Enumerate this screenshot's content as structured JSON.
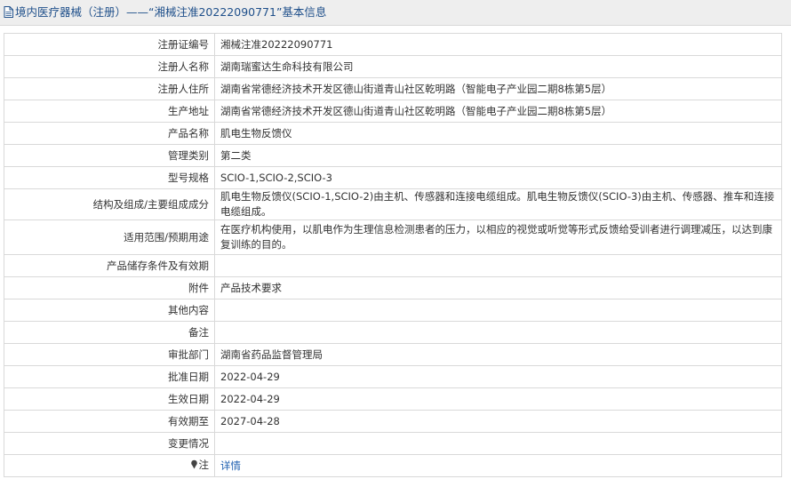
{
  "header": {
    "icon": "document-icon",
    "title": "境内医疗器械（注册）——“湘械注准20222090771”基本信息"
  },
  "rows": [
    {
      "label": "注册证编号",
      "value": "湘械注准20222090771"
    },
    {
      "label": "注册人名称",
      "value": "湖南瑞蜜达生命科技有限公司"
    },
    {
      "label": "注册人住所",
      "value": "湖南省常德经济技术开发区德山街道青山社区乾明路（智能电子产业园二期8栋第5层）"
    },
    {
      "label": "生产地址",
      "value": "湖南省常德经济技术开发区德山街道青山社区乾明路（智能电子产业园二期8栋第5层）"
    },
    {
      "label": "产品名称",
      "value": "肌电生物反馈仪"
    },
    {
      "label": "管理类别",
      "value": "第二类"
    },
    {
      "label": "型号规格",
      "value": "SCIO-1,SCIO-2,SCIO-3"
    },
    {
      "label": "结构及组成/主要组成成分",
      "value": "肌电生物反馈仪(SCIO-1,SCIO-2)由主机、传感器和连接电缆组成。肌电生物反馈仪(SCIO-3)由主机、传感器、推车和连接电缆组成。"
    },
    {
      "label": "适用范围/预期用途",
      "value": "在医疗机构使用，以肌电作为生理信息检测患者的压力，以相应的视觉或听觉等形式反馈给受训者进行调理减压，以达到康复训练的目的。"
    },
    {
      "label": "产品储存条件及有效期",
      "value": ""
    },
    {
      "label": "附件",
      "value": "产品技术要求"
    },
    {
      "label": "其他内容",
      "value": ""
    },
    {
      "label": "备注",
      "value": ""
    },
    {
      "label": "审批部门",
      "value": "湖南省药品监督管理局"
    },
    {
      "label": "批准日期",
      "value": "2022-04-29"
    },
    {
      "label": "生效日期",
      "value": "2022-04-29"
    },
    {
      "label": "有效期至",
      "value": "2027-04-28"
    },
    {
      "label": "变更情况",
      "value": ""
    }
  ],
  "note": {
    "icon": "pin-icon",
    "label": "注",
    "link_text": "详情"
  },
  "colors": {
    "header_bg": "#eeeeee",
    "header_text": "#1e4f8a",
    "border": "#d9d9d9",
    "link": "#1e5fb0"
  }
}
